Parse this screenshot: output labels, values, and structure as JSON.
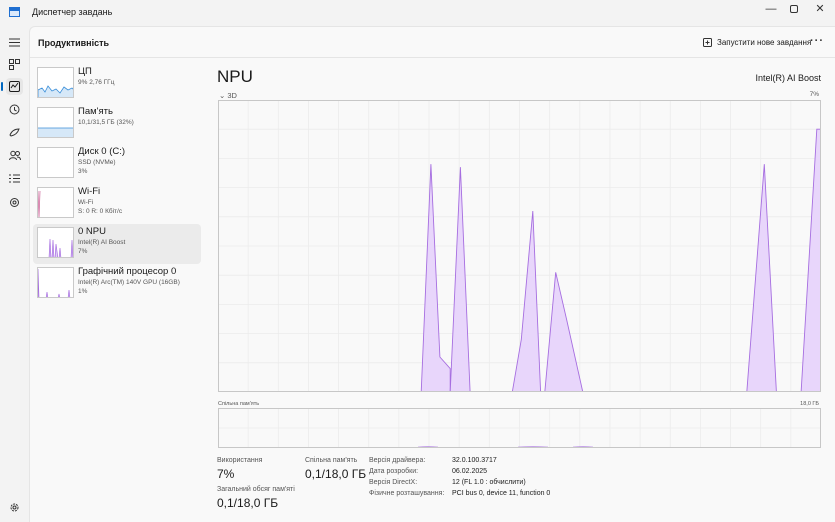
{
  "window": {
    "title": "Диспетчер завдань",
    "controls": [
      "—",
      "▢",
      "✕"
    ]
  },
  "nav": {
    "icons": [
      "hamburger-icon",
      "processes-icon",
      "performance-icon",
      "app-history-icon",
      "startup-apps-icon",
      "users-icon",
      "details-icon",
      "services-icon",
      "settings-icon"
    ],
    "active": "performance-icon"
  },
  "header": {
    "title": "Продуктивність",
    "new_task_label": "Запустити нове завдання",
    "more_label": "···"
  },
  "devices": [
    {
      "name": "ЦП",
      "line1": "9% 2,76 ГГц",
      "line2": ""
    },
    {
      "name": "Пам'ять",
      "line1": "10,1/31,5 ГБ (32%)",
      "line2": ""
    },
    {
      "name": "Диск 0 (C:)",
      "line1": "SSD (NVMe)",
      "line2": "3%"
    },
    {
      "name": "Wi-Fi",
      "line1": "Wi-Fi",
      "line2": "S: 0 R: 0 Кбіт/с"
    },
    {
      "name": "0 NPU",
      "line1": "Intel(R) AI Boost",
      "line2": "7%"
    },
    {
      "name": "Графічний процесор 0",
      "line1": "Intel(R) Arc(TM) 140V GPU (16GB)",
      "line2": "1%"
    }
  ],
  "selected_device": "0 NPU",
  "main": {
    "title": "NPU",
    "model": "Intel(R) AI Boost",
    "engine_label": "3D",
    "engine_max": "7%",
    "mem_label": "Спільна пам'ять",
    "mem_max": "18,0 ГБ"
  },
  "graph": {
    "color_fill": "#e8d6fb",
    "color_line": "#a66ee0",
    "usage_peaks": [
      {
        "start": 0.375,
        "peak_at": 0.392,
        "value": 0.78,
        "end_value": 0.12,
        "end": 0.43
      },
      {
        "start": 0.43,
        "peak_at": 0.445,
        "value": 0.77,
        "end_value": 0.0,
        "end": 0.462
      },
      {
        "start": 0.545,
        "peak_at": 0.578,
        "value": 0.62,
        "end_value": 0.0,
        "end": 0.592
      },
      {
        "start": 0.6,
        "peak_at": 0.625,
        "value": 0.41,
        "end_value": 0.0,
        "end": 0.67
      },
      {
        "start": 0.97,
        "peak_at": 1.0,
        "value": 0.9,
        "end_value": 0.0,
        "end": 1.0
      },
      {
        "start": 0.973,
        "peak_at": 1.0,
        "value": 0.9,
        "end_value": 0.9,
        "end": 1.0
      }
    ]
  },
  "stats": {
    "usage_label": "Використання",
    "usage_value": "7%",
    "shared_label": "Спільна пам'ять",
    "shared_value": "0,1/18,0 ГБ",
    "total_label": "Загальний обсяг пам'яті",
    "total_value": "0,1/18,0 ГБ",
    "details": [
      {
        "key": "Версія драйвера:",
        "value": "32.0.100.3717"
      },
      {
        "key": "Дата розробки:",
        "value": "06.02.2025"
      },
      {
        "key": "Версія DirectX:",
        "value": "12 (FL 1.0 : обчислити)"
      },
      {
        "key": "Фізичне розташування:",
        "value": "PCI bus 0, device 11, function 0"
      }
    ]
  }
}
